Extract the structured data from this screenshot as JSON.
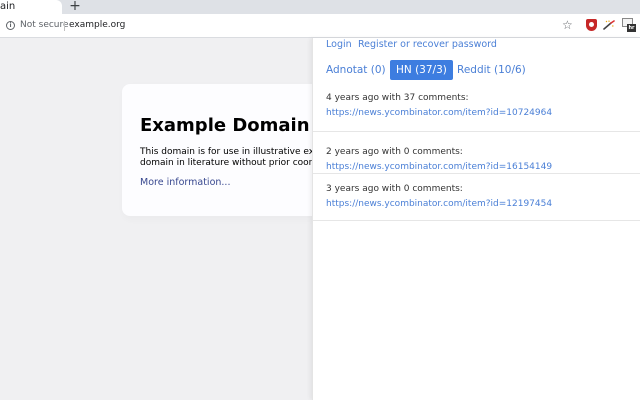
{
  "browser": {
    "tab_title": "ain",
    "new_tab_label": "+",
    "security_label": "Not secure",
    "url": "example.org",
    "extensions": {
      "hn_badge": "hr"
    }
  },
  "page": {
    "heading": "Example Domain",
    "paragraph_line1": "This domain is for use in illustrative examples in documents. You may use this",
    "paragraph_line2": "domain in literature without prior coordination or asking for permission.",
    "link_text": "More information..."
  },
  "panel": {
    "login_label": "Login",
    "register_label": "Register or recover password",
    "tabs": [
      {
        "label": "Adnotat (0)",
        "active": false
      },
      {
        "label": "HN (37/3)",
        "active": true
      },
      {
        "label": "Reddit (10/6)",
        "active": false
      }
    ],
    "items": [
      {
        "meta": "4 years ago with 37 comments:",
        "url": "https://news.ycombinator.com/item?id=10724964"
      },
      {
        "meta": "2 years ago with 0 comments:",
        "url": "https://news.ycombinator.com/item?id=16154149"
      },
      {
        "meta": "3 years ago with 0 comments:",
        "url": "https://news.ycombinator.com/item?id=12197454"
      }
    ]
  },
  "colors": {
    "accent": "#4a7fd6",
    "active_tab_bg": "#3d7de0",
    "page_bg": "#f0f0f2",
    "card_bg": "#fdfdff",
    "page_link": "#38488f"
  }
}
